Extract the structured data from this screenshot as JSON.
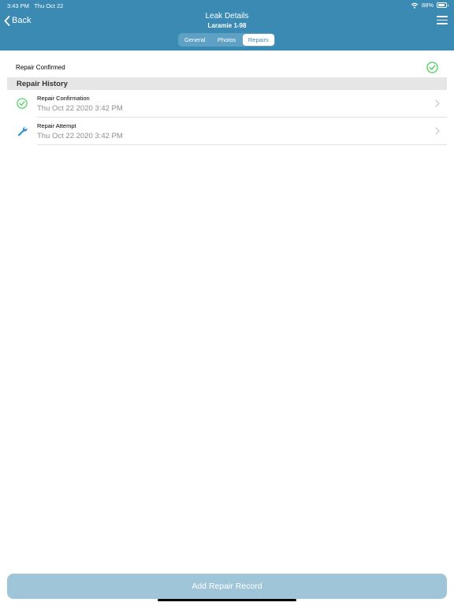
{
  "status_bar": {
    "time": "3:43 PM",
    "date": "Thu Oct 22",
    "battery": "88%"
  },
  "nav": {
    "back_label": "Back",
    "title": "Leak Details",
    "subtitle": "Laramie 1-98"
  },
  "tabs": [
    {
      "label": "General",
      "active": false
    },
    {
      "label": "Photos",
      "active": false
    },
    {
      "label": "Repairs",
      "active": true
    }
  ],
  "repair_confirmed": {
    "label": "Repair Confirmed",
    "icon": "check-circle-icon"
  },
  "repair_history": {
    "title": "Repair History",
    "items": [
      {
        "title": "Repair Confirmation",
        "date": "Thu Oct 22 2020 3:42 PM",
        "icon": "check-circle-icon"
      },
      {
        "title": "Repair Attempt",
        "date": "Thu Oct 22 2020 3:42 PM",
        "icon": "wrench-icon"
      }
    ]
  },
  "footer": {
    "add_label": "Add Repair Record"
  },
  "colors": {
    "header": "#3a8ab3",
    "success": "#2ecc40",
    "button_disabled": "#9ec6d8"
  }
}
